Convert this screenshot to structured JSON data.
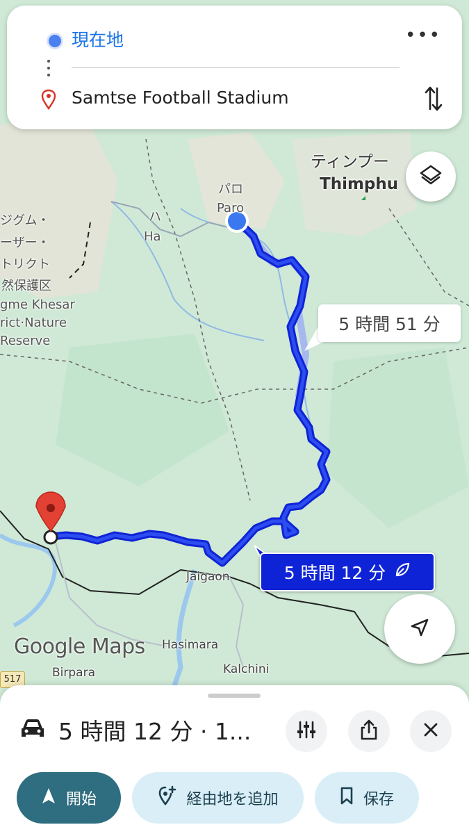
{
  "route_card": {
    "origin": "現在地",
    "destination": "Samtse Football Stadium"
  },
  "map_labels": {
    "thimphu_ja": "ティンプー",
    "thimphu_en": "Thimphu",
    "paro_ja": "パロ",
    "paro_en": "Paro",
    "ha_ja": "ハ",
    "ha_en": "Ha",
    "reserve_ja_1": "ジグム・",
    "reserve_ja_2": "ーザー・",
    "reserve_ja_3": "トリクト",
    "reserve_ja_4": "然保護区",
    "reserve_en_1": "gme Khesar",
    "reserve_en_2": "rict·Nature",
    "reserve_en_3": "Reserve",
    "jaigaon": "Jaigaon",
    "hasimara": "Hasimara",
    "birpara": "Birpara",
    "kalchini": "Kalchini",
    "road_shield": "517"
  },
  "route_times": {
    "alternate": "5 時間 51 分",
    "main": "5 時間 12 分"
  },
  "google_logo": "Google Maps",
  "bottom_sheet": {
    "summary": "5 時間 12 分 · 1...",
    "start_label": "開始",
    "add_stop_label": "経由地を追加",
    "save_label": "保存"
  },
  "colors": {
    "route_main": "#0f23d6",
    "route_alt": "#a6b8ee",
    "origin_blue": "#4a80f0",
    "destination_red": "#d93025",
    "start_button": "#2f6e80",
    "secondary_button": "#d9eef7"
  },
  "icons": [
    "origin-dot-icon",
    "destination-pin-icon",
    "more-icon",
    "swap-icon",
    "layers-icon",
    "leaf-icon",
    "my-location-icon",
    "car-icon",
    "route-options-icon",
    "share-icon",
    "close-icon",
    "navigate-icon",
    "add-stop-icon",
    "bookmark-icon"
  ]
}
